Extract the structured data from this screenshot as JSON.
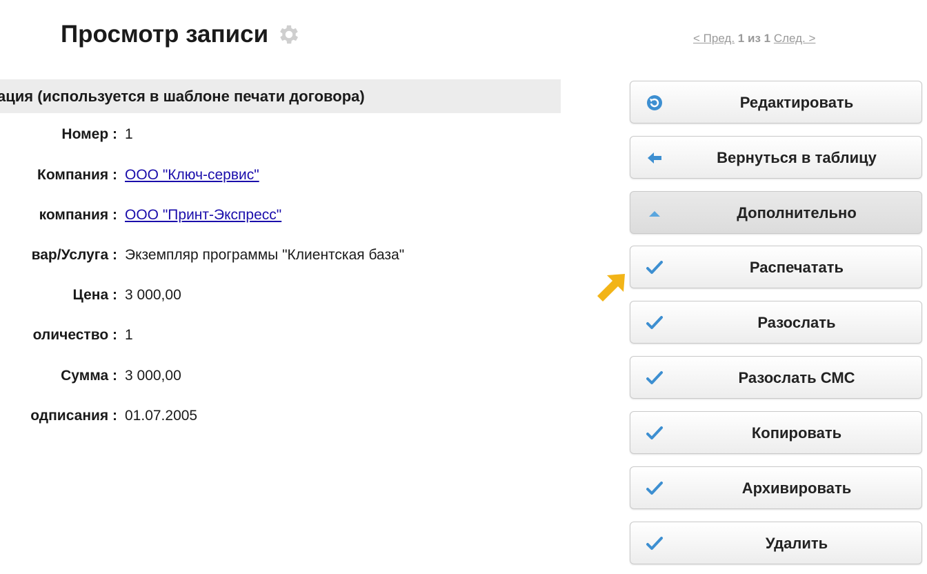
{
  "header": {
    "title": "Просмотр записи",
    "settings_icon": "gear-icon"
  },
  "pager": {
    "prev_label": "< Пред.",
    "current": "1",
    "of_label": "из",
    "total": "1",
    "next_label": "След. >"
  },
  "section": {
    "title": "мация (используется в шаблоне печати договора)"
  },
  "fields": [
    {
      "label": "Номер :",
      "value": "1"
    },
    {
      "label": "Компания :",
      "value": "ООО \"Ключ-сервис\""
    },
    {
      "label": "компания :",
      "value": "ООО \"Принт-Экспресс\""
    },
    {
      "label": "вар/Услуга :",
      "value": "Экземпляр программы \"Клиентская база\""
    },
    {
      "label": "Цена :",
      "value": "3 000,00"
    },
    {
      "label": "оличество :",
      "value": "1"
    },
    {
      "label": "Сумма :",
      "value": "3 000,00"
    },
    {
      "label": "одписания :",
      "value": "01.07.2005"
    }
  ],
  "actions": [
    {
      "label": "Редактировать",
      "icon": "refresh-icon"
    },
    {
      "label": "Вернуться в таблицу",
      "icon": "arrow-left-icon"
    },
    {
      "label": "Дополнительно",
      "icon": "triangle-up-icon"
    },
    {
      "label": "Распечатать",
      "icon": "check-icon"
    },
    {
      "label": "Разослать",
      "icon": "check-icon"
    },
    {
      "label": "Разослать СМС",
      "icon": "check-icon"
    },
    {
      "label": "Копировать",
      "icon": "check-icon"
    },
    {
      "label": "Архивировать",
      "icon": "check-icon"
    },
    {
      "label": "Удалить",
      "icon": "check-icon"
    }
  ],
  "colors": {
    "accent_blue": "#3d8fd1",
    "link": "#1a0dab",
    "pointer_arrow": "#f2b417",
    "section_bg": "#ececec"
  }
}
